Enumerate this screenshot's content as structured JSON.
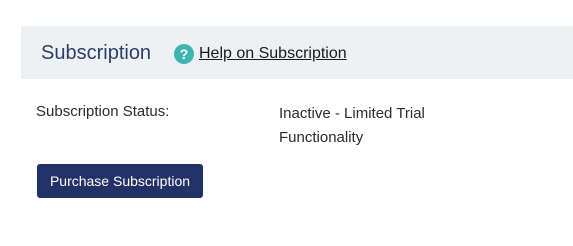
{
  "header": {
    "title": "Subscription",
    "help_icon": "question-circle-icon",
    "help_glyph": "?",
    "help_link_label": "Help on Subscription",
    "background_color": "#eef1f4",
    "title_color": "#2c3e66",
    "icon_color": "#3fb5b0"
  },
  "status": {
    "label": "Subscription Status:",
    "value_line1": "Inactive - Limited Trial",
    "value_line2": "Functionality"
  },
  "actions": {
    "purchase_label": "Purchase Subscription",
    "button_color": "#223266"
  }
}
